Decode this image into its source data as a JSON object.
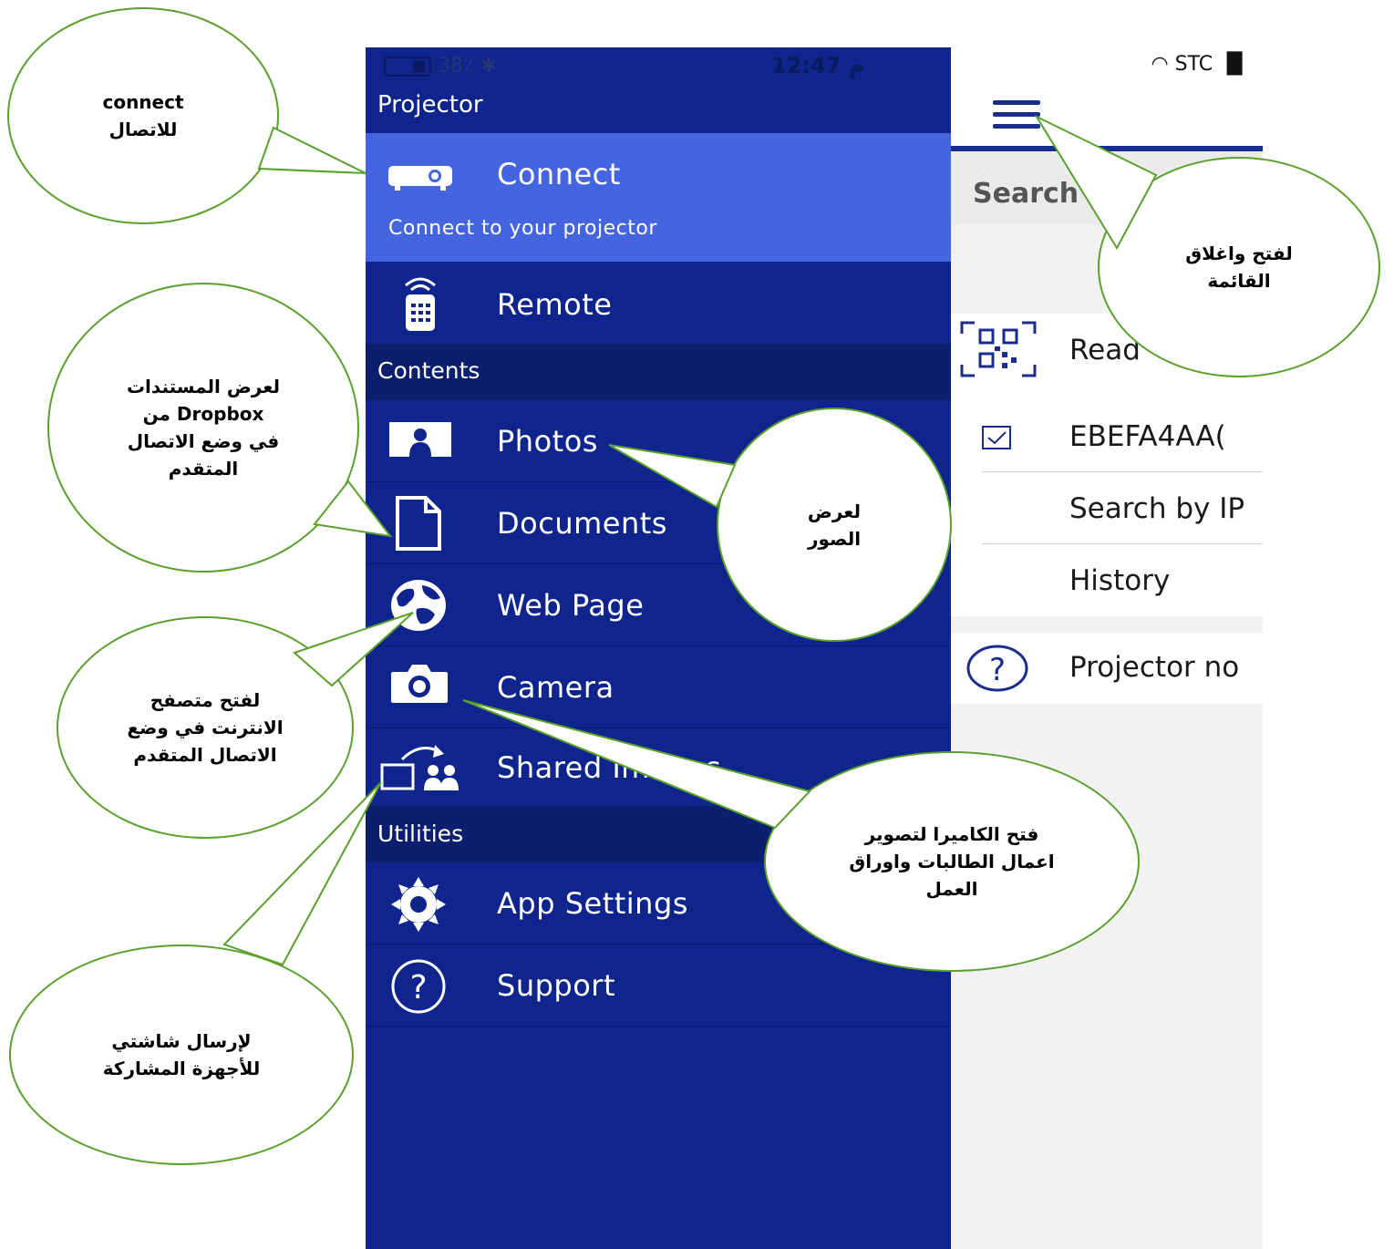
{
  "status": {
    "battery": "38٪",
    "time": "12:47 م",
    "carrier": "STC"
  },
  "drawer": {
    "title": "Projector",
    "connect": {
      "label": "Connect",
      "subtitle": "Connect to your projector"
    },
    "remote": "Remote",
    "sections": {
      "contents": "Contents",
      "utilities": "Utilities"
    },
    "items": [
      "Photos",
      "Documents",
      "Web Page",
      "Camera",
      "Shared Images",
      "App Settings",
      "Support"
    ]
  },
  "main": {
    "search_label": "Search P",
    "qr_row": "Read",
    "projector_row": "EBEFA4AA(",
    "ip_row": "Search by IP",
    "history_row": "History",
    "help_row": "Projector no"
  },
  "callouts": {
    "connect": "connect\nللاتصال",
    "menu": "لفتح واغلاق\nالقائمة",
    "documents": "لعرض المستندات\nمن   Dropbox\nفي وضع الاتصال\nالمتقدم",
    "photos": "لعرض\nالصور",
    "webpage": "لفتح متصفح\nالانترنت في وضع\nالاتصال المتقدم",
    "camera": "فتح الكاميرا لتصوير\nاعمال الطالبات واوراق\nالعمل",
    "shared": "لإرسال شاشتي\nللأجهزة المشاركة"
  },
  "colors": {
    "drawer": "#0f248c",
    "active": "#4565e0",
    "accent": "#1a2d8f",
    "callout_border": "#5aa02c"
  }
}
